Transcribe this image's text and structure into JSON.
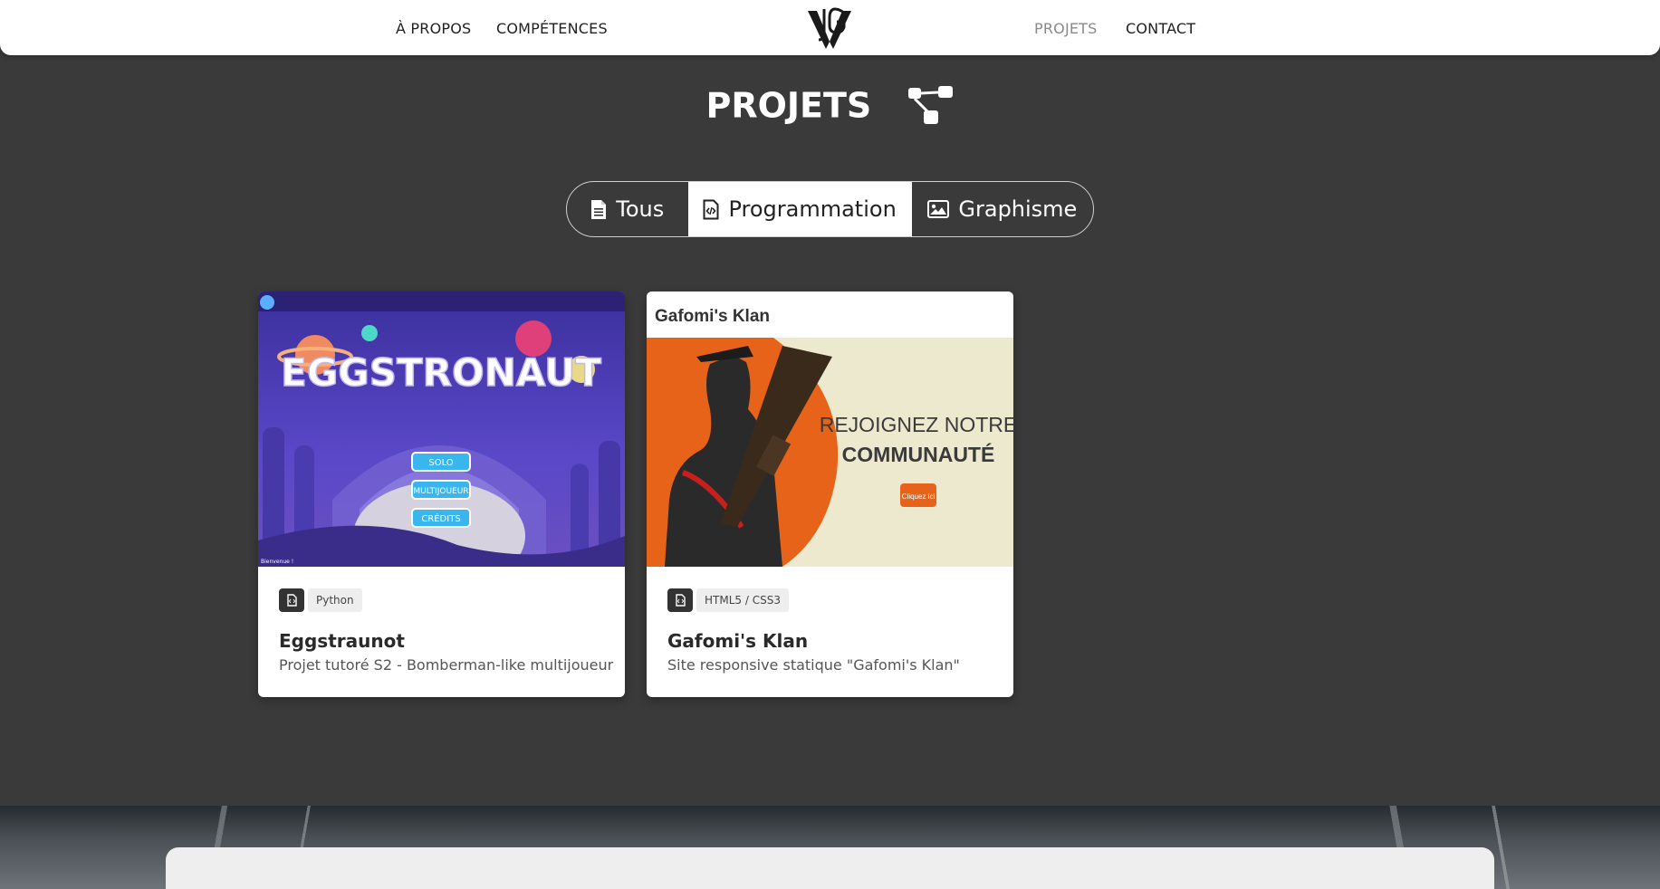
{
  "nav": {
    "links": [
      {
        "label": "À PROPOS"
      },
      {
        "label": "COMPÉTENCES"
      },
      {
        "label": "PROJETS"
      },
      {
        "label": "CONTACT"
      }
    ],
    "logo": "JG-monogram-logo",
    "active_color": "#8a8a8a"
  },
  "section": {
    "title": "PROJETS",
    "icon": "sitemap-icon"
  },
  "filters": {
    "all_label": "Tous",
    "programming_label": "Programmation",
    "graphic_label": "Graphisme",
    "selected": "Programmation"
  },
  "projects": [
    {
      "image": {
        "game_title": "EGGSTRONAUT",
        "menu": [
          "SOLO",
          "MULTIJOUEUR",
          "CRÉDITS"
        ],
        "footer_hint": "Bienvenue !"
      },
      "tag": "Python",
      "title": "Eggstraunot",
      "description": "Projet tutoré S2 - Bomberman-like multijoueur"
    },
    {
      "image": {
        "site_name": "Gafomi's Klan",
        "headline_line1": "REJOIGNEZ NOTRE",
        "headline_line2": "COMMUNAUTÉ",
        "cta": "Cliquez ici"
      },
      "tag": "HTML5 / CSS3",
      "title": "Gafomi's Klan",
      "description": "Site responsive statique \"Gafomi's Klan\""
    }
  ],
  "colors": {
    "page_bg": "#3a3a3a",
    "accent_orange": "#e8631a",
    "game_bg_purple": "#5a48b8"
  }
}
